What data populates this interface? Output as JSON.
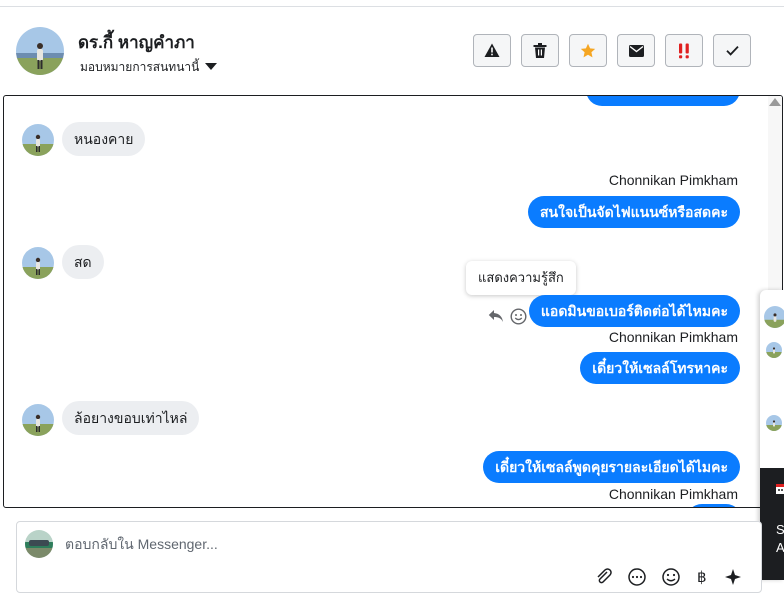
{
  "header": {
    "contact_name": "ดร.กี้ หาญคำภา",
    "assign_label": "มอบหมายการสนทนานี้",
    "actions": [
      {
        "name": "spam",
        "icon": "warning-icon"
      },
      {
        "name": "delete",
        "icon": "trash-icon"
      },
      {
        "name": "follow-up",
        "icon": "star-icon",
        "color": "#f5a623"
      },
      {
        "name": "mark-unread",
        "icon": "envelope-icon"
      },
      {
        "name": "priority",
        "icon": "double-exclamation-icon",
        "color": "#e02020"
      },
      {
        "name": "done",
        "icon": "checkmark-icon"
      }
    ]
  },
  "chat": {
    "messages": [
      {
        "direction": "in",
        "text": "หนองคาย"
      },
      {
        "direction": "out",
        "sender": "Chonnikan Pimkham",
        "text": "สนใจเป็นจัดไฟแนนซ์หรือสดคะ"
      },
      {
        "direction": "in",
        "text": "สด"
      },
      {
        "direction": "out",
        "text": "แอดมินขอเบอร์ติดต่อได้ไหมคะ"
      },
      {
        "direction": "out",
        "sender": "Chonnikan Pimkham",
        "text": "เดี๋ยวให้เซลล์โทรหาคะ"
      },
      {
        "direction": "in",
        "text": "ล้อยางขอบเท่าไหล่"
      },
      {
        "direction": "out",
        "text": "เดี๋ยวให้เซลล์พูดคุยรายละเอียดได้ไมคะ"
      },
      {
        "direction": "out",
        "sender": "Chonnikan Pimkham",
        "text": ""
      }
    ],
    "tooltip": "แสดงความรู้สึก"
  },
  "side_panel": {
    "text_line1": "S",
    "text_line2": "A"
  },
  "reply": {
    "placeholder": "ตอบกลับใน Messenger..."
  },
  "colors": {
    "accent": "#0a7cff",
    "incoming_bubble": "#eceef1",
    "star": "#f5a623",
    "priority": "#e02020"
  }
}
